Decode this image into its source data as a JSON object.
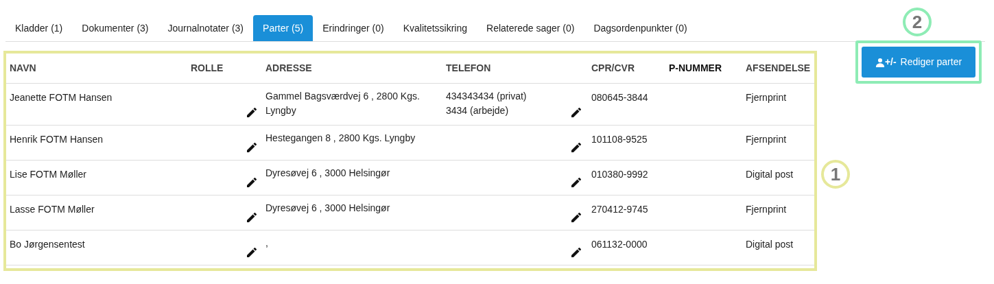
{
  "tabs": [
    {
      "label": "Kladder (1)",
      "selected": false
    },
    {
      "label": "Dokumenter (3)",
      "selected": false
    },
    {
      "label": "Journalnotater (3)",
      "selected": false
    },
    {
      "label": "Parter (5)",
      "selected": true
    },
    {
      "label": "Erindringer (0)",
      "selected": false
    },
    {
      "label": "Kvalitetssikring",
      "selected": false
    },
    {
      "label": "Relaterede sager (0)",
      "selected": false
    },
    {
      "label": "Dagsordenpunkter (0)",
      "selected": false
    }
  ],
  "table": {
    "columns": [
      "NAVN",
      "ROLLE",
      "ADRESSE",
      "TELEFON",
      "CPR/CVR",
      "P-NUMMER",
      "AFSENDELSE"
    ],
    "rows": [
      {
        "navn": "Jeanette FOTM Hansen",
        "adresse": [
          "Gammel Bagsværdvej 6 , 2800 Kgs.",
          "Lyngby"
        ],
        "telefon": [
          "434343434 (privat)",
          "3434 (arbejde)"
        ],
        "cpr": "080645-3844",
        "afsendelse": "Fjernprint"
      },
      {
        "navn": "Henrik FOTM Hansen",
        "adresse": [
          "Hestegangen 8 , 2800 Kgs. Lyngby"
        ],
        "telefon": [],
        "cpr": "101108-9525",
        "afsendelse": "Fjernprint"
      },
      {
        "navn": "Lise FOTM Møller",
        "adresse": [
          "Dyresøvej 6 , 3000 Helsingør"
        ],
        "telefon": [],
        "cpr": "010380-9992",
        "afsendelse": "Digital post"
      },
      {
        "navn": "Lasse FOTM Møller",
        "adresse": [
          "Dyresøvej 6 , 3000 Helsingør"
        ],
        "telefon": [],
        "cpr": "270412-9745",
        "afsendelse": "Fjernprint"
      },
      {
        "navn": "Bo Jørgensentest",
        "adresse": [
          ","
        ],
        "telefon": [],
        "cpr": "061132-0000",
        "afsendelse": "Digital post"
      }
    ]
  },
  "edit_button": {
    "label": "+/- Rediger parter"
  },
  "annotations": [
    {
      "label": "1",
      "color": "#e6e89a"
    },
    {
      "label": "2",
      "color": "#8eecb5"
    }
  ]
}
